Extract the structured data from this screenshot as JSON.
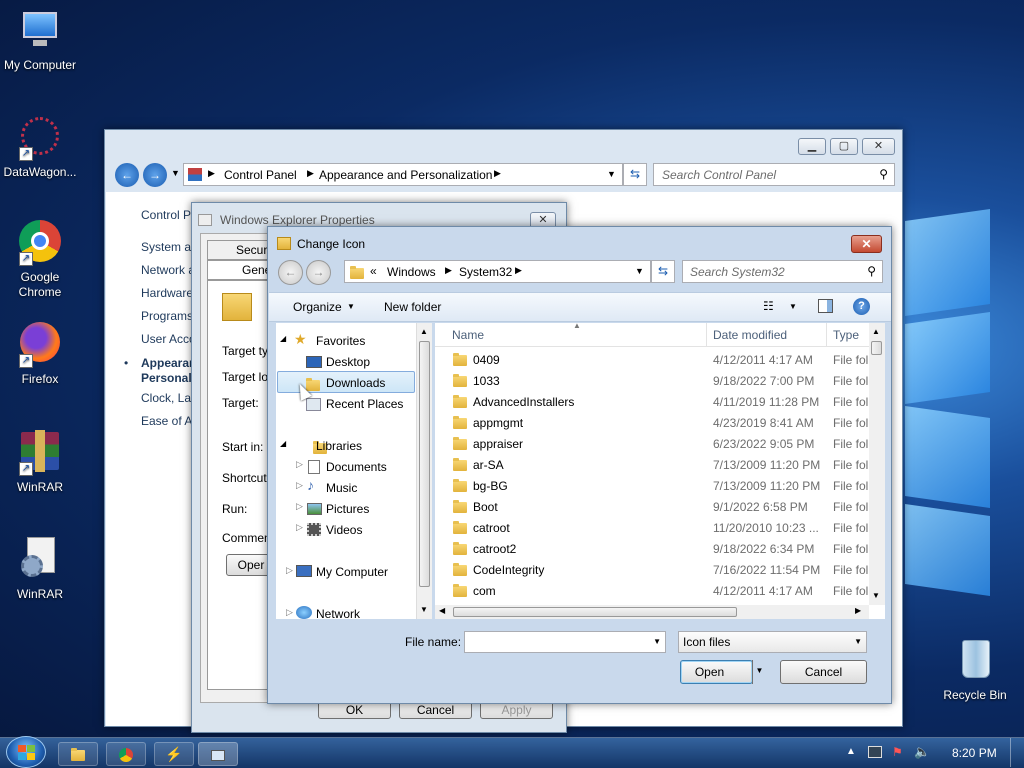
{
  "desktop": {
    "icons": [
      {
        "label": "My Computer",
        "icon": "computer-icon"
      },
      {
        "label": "DataWagon...",
        "icon": "datawagon-icon"
      },
      {
        "label": "Google Chrome",
        "icon": "chrome-icon"
      },
      {
        "label": "Firefox",
        "icon": "firefox-icon"
      },
      {
        "label": "WinRAR",
        "icon": "winrar-icon"
      },
      {
        "label": "WinRAR",
        "icon": "winrar-setup-icon"
      },
      {
        "label": "Recycle Bin",
        "icon": "recycle-bin-icon"
      }
    ]
  },
  "control_panel": {
    "breadcrumb": [
      "Control Panel",
      "Appearance and Personalization"
    ],
    "search_placeholder": "Search Control Panel",
    "sidebar": [
      "Control P",
      "System ar",
      "Network a",
      "Hardware",
      "Programs",
      "User Acco",
      "Appearan",
      "Personali",
      "Clock, La",
      "Ease of A"
    ]
  },
  "properties": {
    "title": "Windows Explorer Properties",
    "tabs": [
      "Secur",
      "Gene"
    ],
    "fields": [
      "Target ty",
      "Target lo",
      "Target:",
      "Start in:",
      "Shortcut",
      "Run:",
      "Commen"
    ],
    "open_btn": "Oper",
    "ok": "OK",
    "cancel": "Cancel",
    "apply": "Apply"
  },
  "change_icon": {
    "title": "Change Icon",
    "address": [
      "Windows",
      "System32"
    ],
    "address_prefix": "«",
    "search_placeholder": "Search System32",
    "toolbar": {
      "organize": "Organize",
      "new_folder": "New folder"
    },
    "nav": {
      "favorites": "Favorites",
      "desktop": "Desktop",
      "downloads": "Downloads",
      "recent": "Recent Places",
      "libraries": "Libraries",
      "documents": "Documents",
      "music": "Music",
      "pictures": "Pictures",
      "videos": "Videos",
      "my_computer": "My Computer",
      "network": "Network"
    },
    "columns": {
      "name": "Name",
      "date": "Date modified",
      "type": "Type"
    },
    "files": [
      {
        "name": "0409",
        "date": "4/12/2011 4:17 AM",
        "type": "File fol"
      },
      {
        "name": "1033",
        "date": "9/18/2022 7:00 PM",
        "type": "File fol"
      },
      {
        "name": "AdvancedInstallers",
        "date": "4/11/2019 11:28 PM",
        "type": "File fol"
      },
      {
        "name": "appmgmt",
        "date": "4/23/2019 8:41 AM",
        "type": "File fol"
      },
      {
        "name": "appraiser",
        "date": "6/23/2022 9:05 PM",
        "type": "File fol"
      },
      {
        "name": "ar-SA",
        "date": "7/13/2009 11:20 PM",
        "type": "File fol"
      },
      {
        "name": "bg-BG",
        "date": "7/13/2009 11:20 PM",
        "type": "File fol"
      },
      {
        "name": "Boot",
        "date": "9/1/2022 6:58 PM",
        "type": "File fol"
      },
      {
        "name": "catroot",
        "date": "11/20/2010 10:23 ...",
        "type": "File fol"
      },
      {
        "name": "catroot2",
        "date": "9/18/2022 6:34 PM",
        "type": "File fol"
      },
      {
        "name": "CodeIntegrity",
        "date": "7/16/2022 11:54 PM",
        "type": "File fol"
      },
      {
        "name": "com",
        "date": "4/12/2011 4:17 AM",
        "type": "File fol"
      }
    ],
    "file_name_label": "File name:",
    "file_name_value": "",
    "filter": "Icon files",
    "open": "Open",
    "cancel": "Cancel"
  },
  "taskbar": {
    "clock": "8:20 PM"
  }
}
